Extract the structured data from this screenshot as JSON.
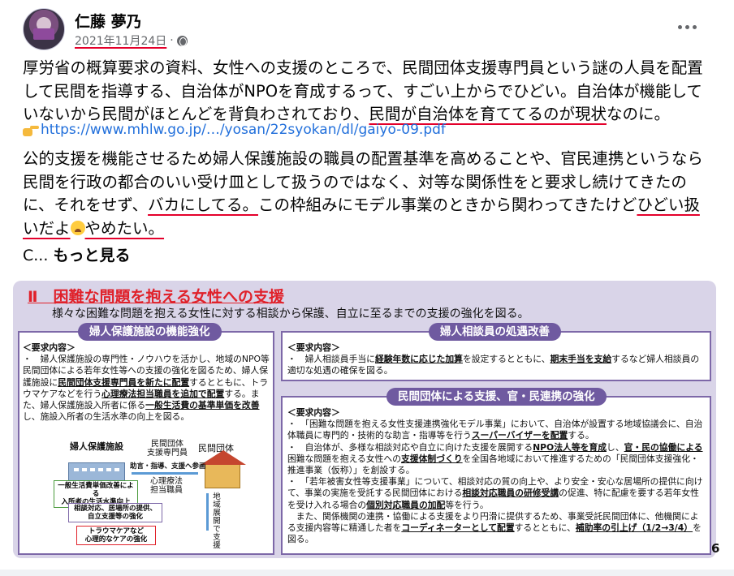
{
  "post": {
    "author": "仁藤 夢乃",
    "date": "2021年11月24日",
    "date_sep": "·",
    "paragraph1": {
      "part1": "厚労省の概算要求の資料、女性への支援のところで、民間団体支援専門員という謎の人員を配置して民間を指導する、自治体がNPOを育成するって、すごい上からでひどい。自治体が機能していないから民間がほとんどを背負わされており、",
      "underline": "民間が自治体を育ててるのが現状",
      "part2": "なのに。"
    },
    "link": "https://www.mhlw.go.jp/…/yosan/22syokan/dl/gaiyo-09.pdf",
    "paragraph2": {
      "part1": "公的支援を機能させるため婦人保護施設の職員の配置基準を高めることや、官民連携というなら民間を行政の都合のいい受け皿として扱うのではなく、対等な関係性をと要求し続けてきたのに、それをせず、",
      "underline1": "バカにしてる。",
      "part2": "この枠組みにモデル事業のときから関わってきたけど",
      "underline2": "ひどい扱いだよ",
      "underline3": "やめたい。"
    },
    "truncated": "C...",
    "see_more": "もっと見る"
  },
  "slide": {
    "title": "Ⅱ　困難な問題を抱える女性への支援",
    "subtitle": "様々な困難な問題を抱える女性に対する相談から保護、自立に至るまでの支援の強化を図る。",
    "left_box": {
      "header": "婦人保護施設の機能強化",
      "req": "＜要求内容＞",
      "text_a": "・　婦人保護施設の専門性・ノウハウを活かし、地域のNPO等民間団体による若年女性等への支援の強化を図るため、婦人保護施設に",
      "bold_a": "民間団体支援専門員を新たに配置",
      "text_b": "するとともに、トラウマケアなどを行う",
      "bold_b": "心理療法担当職員を追加で配置",
      "text_c": "する。また、婦人保護施設入所者に係る",
      "bold_c": "一般生活費の基準単価を改善",
      "text_d": "し、施設入所者の生活水準の向上を図る。",
      "diagram": {
        "facility": "婦人保護施設",
        "staff1": "民間団体\n支援専門員",
        "org": "民間団体",
        "assist": "助言・指導、支援へ参画",
        "staff2": "心理療法\n担当職員",
        "box1": "一般生活費単価改善による\n入所者の生活水準向上",
        "box2": "相談対応、居場所の提供、\n自立支援等の強化",
        "box3": "トラウマケアなど\n心理的なケアの強化",
        "vertical": "地域展開で支援"
      }
    },
    "right_box1": {
      "header": "婦人相談員の処遇改善",
      "req": "＜要求内容＞",
      "text_a": "・　婦人相談員手当に",
      "bold_a": "経験年数に応じた加算",
      "text_b": "を設定するとともに、",
      "bold_b": "期末手当を支給",
      "text_c": "するなど婦人相談員の適切な処遇の確保を図る。"
    },
    "right_box2": {
      "header": "民間団体による支援、官・民連携の強化",
      "req": "＜要求内容＞",
      "item1": "・　「困難な問題を抱える女性支援連携強化モデル事業」において、自治体が設置する地域協議会に、自治体職員に専門的・技術的な助言・指導等を行う",
      "item1_bold": "スーパーバイザーを配置",
      "item1_end": "する。",
      "item2": "・　自治体が、多様な相談対応や自立に向けた支援を展開する",
      "item2_bold": "NPO法人等を育成",
      "item2_mid": "し、",
      "item2_bold2": "官・民の協働による",
      "item2_mid2": "困難な問題を抱える女性への",
      "item2_bold3": "支援体制づくり",
      "item2_end": "を全国各地域において推進するための「民間団体支援強化・推進事業（仮称）」を創設する。",
      "item3": "・　「若年被害女性等支援事業」について、相談対応の質の向上や、より安全・安心な居場所の提供に向けて、事業の実施を受託する民間団体における",
      "item3_bold": "相談対応職員の研修受講",
      "item3_mid": "の促進、特に配慮を要する若年女性を受け入れる場合の",
      "item3_bold2": "個別対応職員の加配",
      "item3_end": "等を行う。",
      "item4": "　また、関係機関の連携・協働による支援をより円滑に提供するため、事業受託民間団体に、他機関による支援内容等に精通した者を",
      "item4_bold": "コーディネーターとして配置",
      "item4_mid": "するとともに、",
      "item4_bold2": "補助率の引上げ（1/2→3/4）",
      "item4_end": "を図る。"
    },
    "page_number": "6"
  },
  "colors": {
    "link": "#216fdb",
    "underline_annotation": "#e4002b",
    "slide_accent": "#6f5aa0",
    "slide_title": "#e0212a"
  },
  "icons": [
    "globe-icon",
    "more-options-icon",
    "pointing-hand-emoji",
    "crying-face-emoji"
  ]
}
